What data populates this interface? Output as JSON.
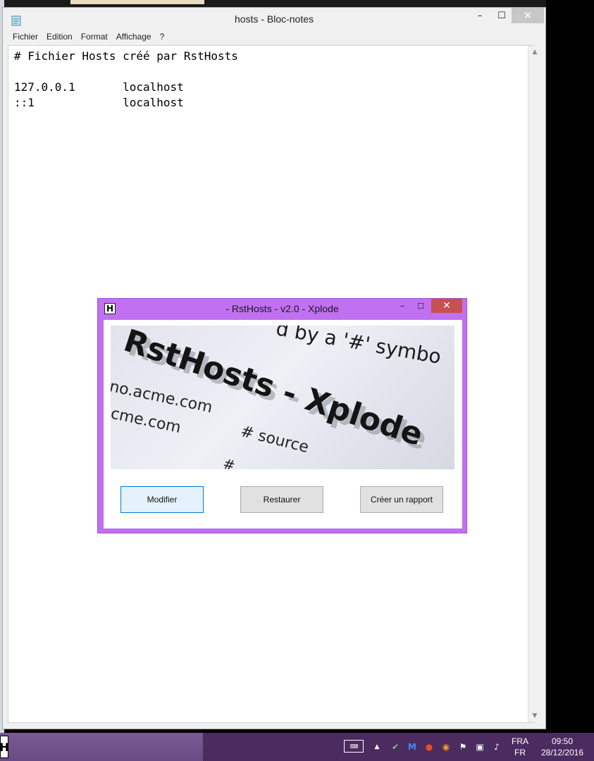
{
  "notepad": {
    "title": "hosts - Bloc-notes",
    "controls": {
      "minimize": "–",
      "maximize": "☐",
      "close": "✕"
    },
    "menu": [
      "Fichier",
      "Edition",
      "Format",
      "Affichage",
      "?"
    ],
    "content": "# Fichier Hosts créé par RstHosts\n\n127.0.0.1       localhost\n::1             localhost"
  },
  "dialog": {
    "icon_letter": "H",
    "title": "- RstHosts - v2.0 - Xplode",
    "controls": {
      "minimize": "–",
      "maximize": "☐",
      "close": "✕"
    },
    "banner": {
      "logo_text": "RstHosts - Xplode",
      "bg_text_1": "d by a '#' symbo",
      "bg_text_2": "no.acme.com",
      "bg_text_3": "cme.com",
      "bg_text_4": "# source",
      "bg_text_5": "#"
    },
    "buttons": {
      "modifier": "Modifier",
      "restaurer": "Restaurer",
      "rapport": "Créer un rapport"
    }
  },
  "taskbar": {
    "app_letter": "H",
    "keyboard_icon": "⌨",
    "tray_up": "▲",
    "language_top": "FRA",
    "language_bottom": "FR",
    "time": "09:50",
    "date": "28/12/2016"
  }
}
